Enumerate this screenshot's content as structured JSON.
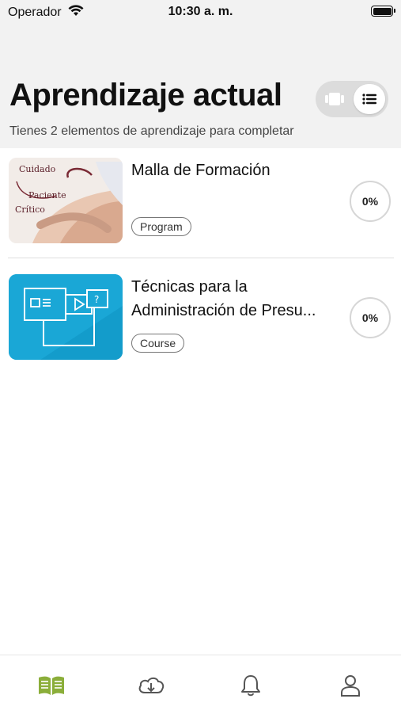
{
  "status_bar": {
    "carrier": "Operador",
    "time": "10:30 a. m."
  },
  "header": {
    "title": "Aprendizaje actual",
    "subtitle": "Tienes 2 elementos de aprendizaje para completar"
  },
  "view_toggle": {
    "selected": "list"
  },
  "items": [
    {
      "title": "Malla de Formación",
      "type": "Program",
      "progress": "0%",
      "thumbnail_text": [
        "Cuidado",
        "Paciente",
        "Crítico"
      ]
    },
    {
      "title": "Técnicas para la Administración de Presu...",
      "type": "Course",
      "progress": "0%"
    }
  ],
  "tab_bar": {
    "active": "learning",
    "tabs": [
      "learning",
      "downloads",
      "notifications",
      "profile"
    ],
    "active_color": "#8BAE3A"
  },
  "colors": {
    "course_thumb_bg": "#1AA7D6"
  }
}
